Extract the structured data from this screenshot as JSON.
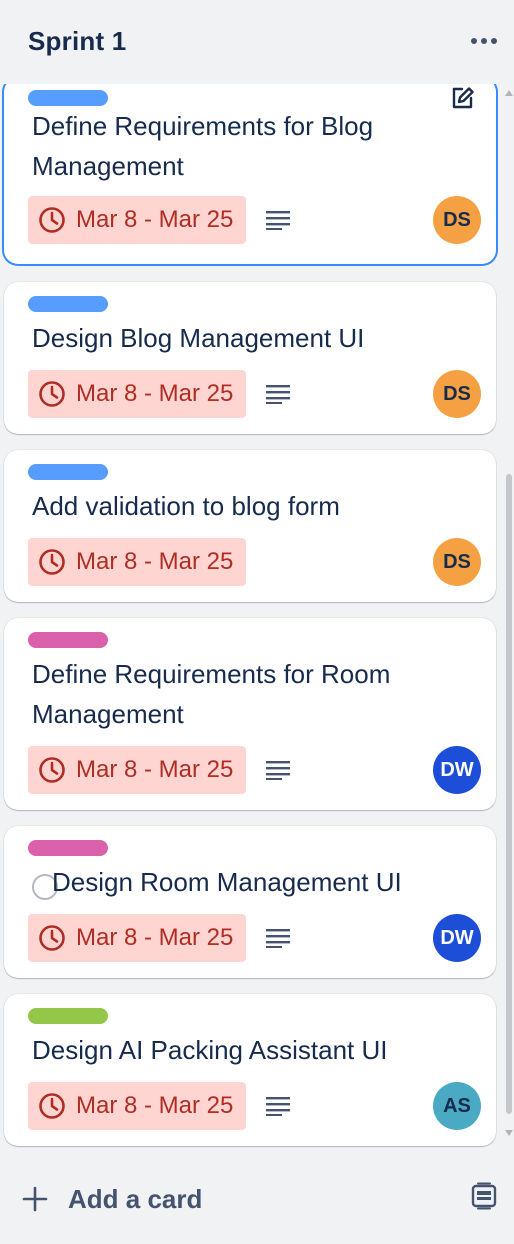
{
  "list": {
    "title": "Sprint 1"
  },
  "cards": [
    {
      "title": "Define Requirements for Blog Management",
      "label_color": "#579dff",
      "due": "Mar 8 - Mar 25",
      "has_description": true,
      "member": "DS",
      "member_color": "#f5a143",
      "active": true
    },
    {
      "title": "Design Blog Management UI",
      "label_color": "#579dff",
      "due": "Mar 8 - Mar 25",
      "has_description": true,
      "member": "DS",
      "member_color": "#f5a143"
    },
    {
      "title": "Add validation to blog form",
      "label_color": "#579dff",
      "due": "Mar 8 - Mar 25",
      "has_description": false,
      "member": "DS",
      "member_color": "#f5a143"
    },
    {
      "title": "Define Requirements for Room Management",
      "label_color": "#da62ac",
      "due": "Mar 8 - Mar 25",
      "has_description": true,
      "member": "DW",
      "member_color": "#1d4ed8"
    },
    {
      "title": "Design Room Management UI",
      "label_color": "#da62ac",
      "due": "Mar 8 - Mar 25",
      "has_description": true,
      "member": "DW",
      "member_color": "#1d4ed8"
    },
    {
      "title": "Design AI Packing Assistant UI",
      "label_color": "#94c748",
      "due": "Mar 8 - Mar 25",
      "has_description": true,
      "member": "AS",
      "member_color": "#4aaac4"
    }
  ],
  "footer": {
    "add_card_label": "Add a card"
  },
  "icons": {
    "more": "more-horizontal-icon",
    "edit": "pencil-edit-icon",
    "clock": "clock-icon",
    "description": "description-lines-icon",
    "plus": "plus-icon",
    "template": "card-template-icon"
  }
}
